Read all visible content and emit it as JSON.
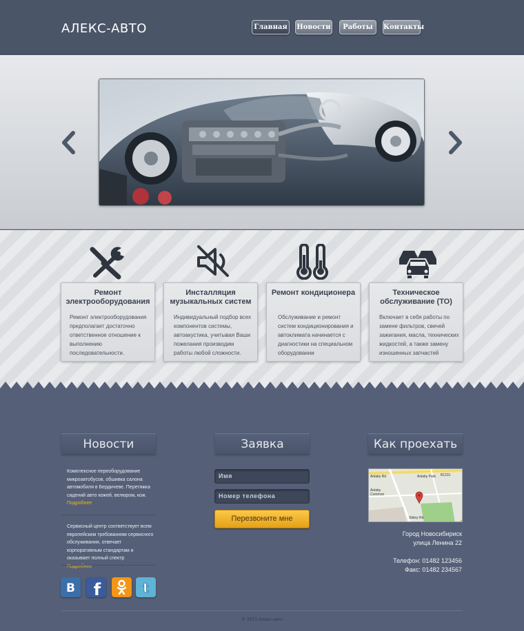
{
  "header": {
    "logo": "АЛЕКС-АВТО",
    "nav": [
      {
        "label": "Главная",
        "active": true
      },
      {
        "label": "Новости",
        "active": false
      },
      {
        "label": "Работы",
        "active": false
      },
      {
        "label": "Контакты",
        "active": false
      }
    ]
  },
  "slider": {
    "prev_icon": "chevron-left-icon",
    "next_icon": "chevron-right-icon",
    "slide_subject": "car-engine-cutaway"
  },
  "services": [
    {
      "icon": "wrench-screwdriver-icon",
      "title": "Ремонт электрооборудования",
      "text": "Ремонт электрооборудования предполагает достаточно ответственное отношение к выполнению последовательности."
    },
    {
      "icon": "speaker-muted-icon",
      "title": "Инсталляция музыкальных систем",
      "text": "Индивидуальный подбор всех компонентов системы, автоакустика, учитывая Ваши пожелания производим работы любой сложности."
    },
    {
      "icon": "thermometers-icon",
      "title": "Ремонт кондиционера",
      "text": "Обслуживание и ремонт систем кондиционирования и автоклимата начинается с диагностики на специальном оборудовании"
    },
    {
      "icon": "cars-icon",
      "title": "Техническое обслуживание (ТО)",
      "text": "Включает в себя работы по замене фильтров, свечей зажигания, масла, технических жидкостей, а также замену изношенных запчастей"
    }
  ],
  "news": {
    "heading": "Новости",
    "items": [
      {
        "text": "Комплексное переоборудование микроавтобусов, обшивка салона автомобиля в Бердичеве. Перетяжка сидений авто кожей, велюром, кож.",
        "link": "Подробнее"
      },
      {
        "text": "Сервисный центр соответствует всем европейским требованиям сервисного обслуживания, отвечает корпоративным стандартам и оказывает полный спектр",
        "link": "Подробнее"
      }
    ]
  },
  "order": {
    "heading": "Заявка",
    "name_placeholder": "Имя",
    "phone_placeholder": "Номер телефона",
    "submit_label": "Перезвоните мне"
  },
  "directions": {
    "heading": "Как проехать",
    "map_labels": [
      "Anlaby Park",
      "Anlaby Common",
      "B1231",
      "Anlaby Rd",
      "Sibley Rd"
    ],
    "city": "Город Новосибириск",
    "street": "улица Ленина 22",
    "phone": "Телефон: 01482 123456",
    "fax": "Факс: 01482 234567"
  },
  "social": [
    {
      "icon": "vk-icon",
      "color": "#3b6fa8"
    },
    {
      "icon": "facebook-icon",
      "color": "#3b5b9a"
    },
    {
      "icon": "odnoklassniki-icon",
      "color": "#f29518"
    },
    {
      "icon": "twitter-icon",
      "color": "#5fb3d6"
    }
  ],
  "footer": {
    "copyright": "© 2015 Алекс-авто"
  },
  "colors": {
    "header_bg": "#4b5568",
    "body_bg": "#556078",
    "accent": "#f0b420"
  }
}
